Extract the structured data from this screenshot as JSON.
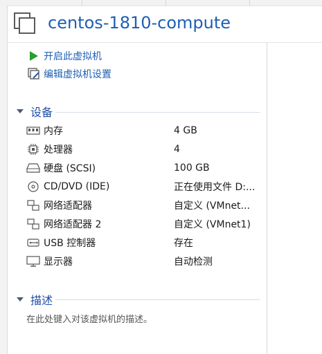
{
  "vm": {
    "title": "centos-1810-compute"
  },
  "actions": [
    {
      "label": "开启此虚拟机",
      "icon": "play-icon"
    },
    {
      "label": "编辑虚拟机设置",
      "icon": "edit-settings-icon"
    }
  ],
  "devices_section": {
    "title": "设备"
  },
  "devices": [
    {
      "name": "内存",
      "value": "4 GB",
      "icon": "memory-icon"
    },
    {
      "name": "处理器",
      "value": "4",
      "icon": "processor-icon"
    },
    {
      "name": "硬盘 (SCSI)",
      "value": "100 GB",
      "icon": "hard-disk-icon"
    },
    {
      "name": "CD/DVD (IDE)",
      "value": "正在使用文件 D:...",
      "icon": "cd-dvd-icon"
    },
    {
      "name": "网络适配器",
      "value": "自定义 (VMnet...",
      "icon": "network-adapter-icon"
    },
    {
      "name": "网络适配器 2",
      "value": "自定义 (VMnet1)",
      "icon": "network-adapter-icon"
    },
    {
      "name": "USB 控制器",
      "value": "存在",
      "icon": "usb-icon"
    },
    {
      "name": "显示器",
      "value": "自动检测",
      "icon": "monitor-icon"
    }
  ],
  "description_section": {
    "title": "描述",
    "placeholder": "在此处键入对该虚拟机的描述。"
  },
  "colors": {
    "link": "#1e5fb3",
    "section_title": "#1e4fa8",
    "play_green": "#2a9d2a"
  }
}
